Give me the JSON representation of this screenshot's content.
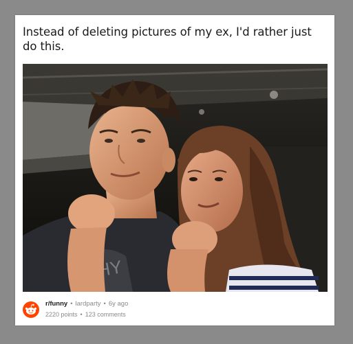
{
  "post": {
    "title": "Instead of deleting pictures of my ex, I'd rather just do this.",
    "subreddit": "r/funny",
    "author": "lardparty",
    "age": "6y ago",
    "points": "2220 points",
    "comments": "123 comments",
    "separator": "•"
  },
  "icons": {
    "subreddit_icon": "reddit-alien-icon"
  },
  "colors": {
    "background": "#8a8a8a",
    "card": "#ffffff",
    "reddit_orange": "#ff4500",
    "meta_gray": "#878a8c"
  }
}
